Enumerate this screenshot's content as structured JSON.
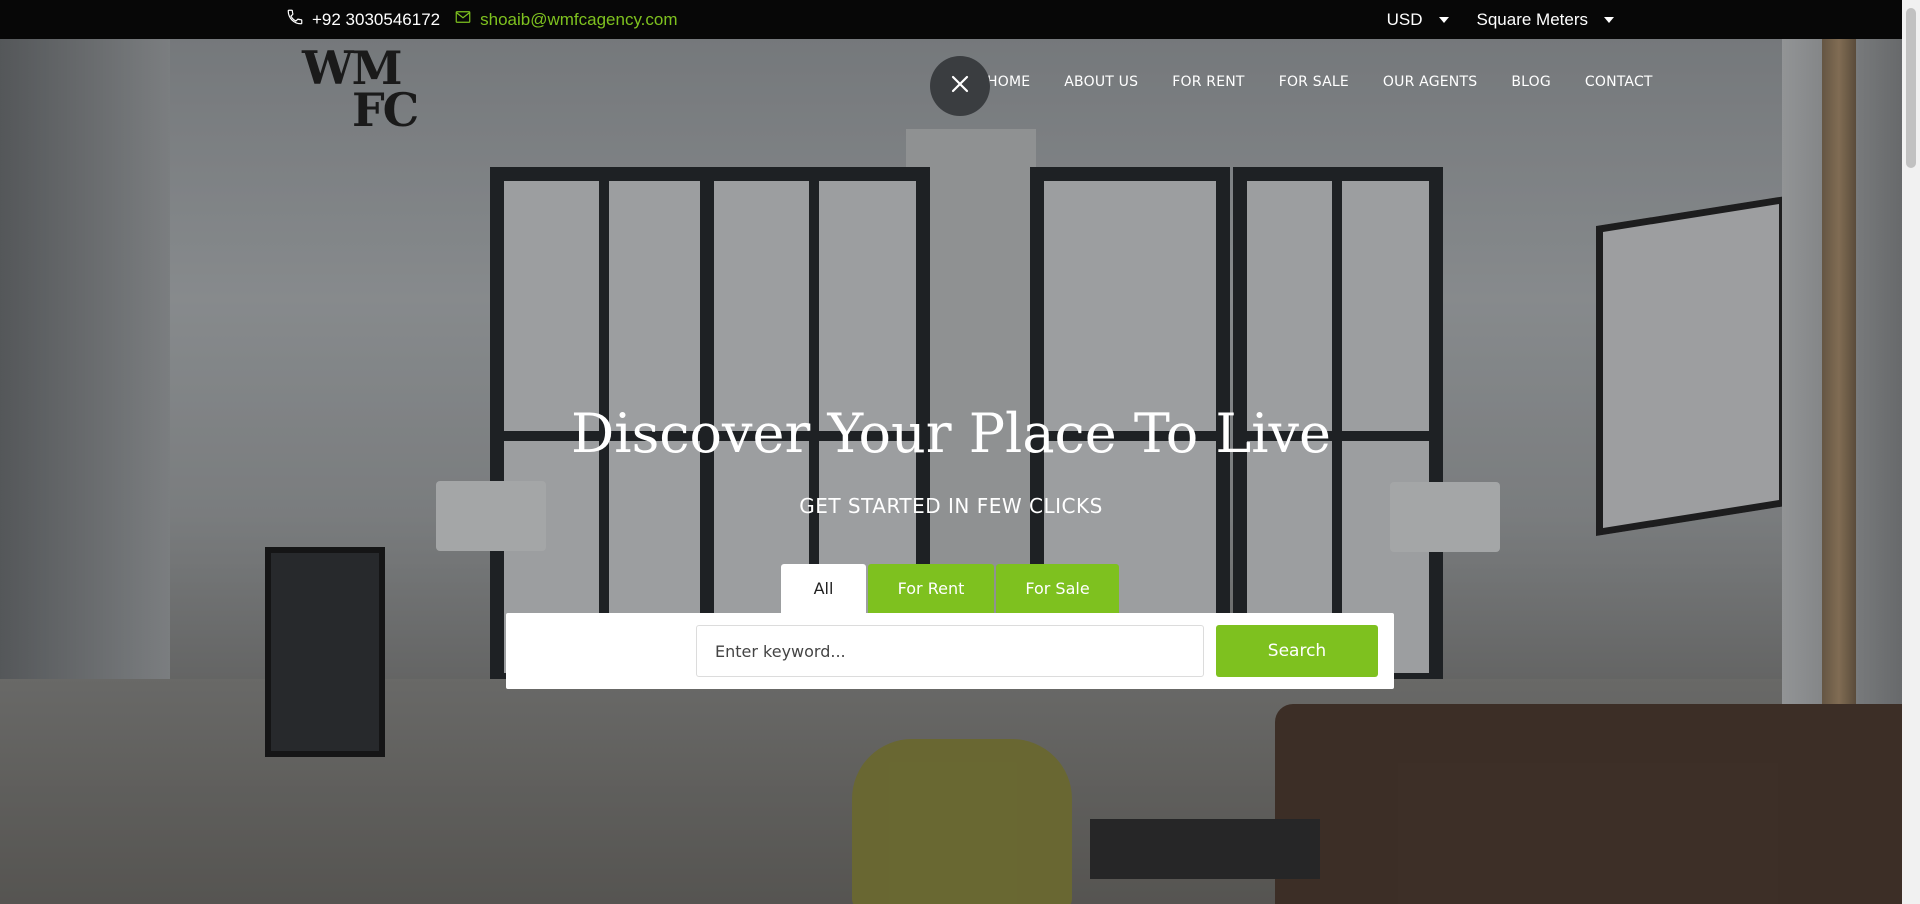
{
  "topbar": {
    "phone": "+92 3030546172",
    "email": "shoaib@wmfcagency.com",
    "currency": "USD",
    "unit": "Square Meters"
  },
  "header": {
    "logo_line1": "WM",
    "logo_line2": "FC",
    "nav": [
      "HOME",
      "ABOUT US",
      "FOR RENT",
      "FOR SALE",
      "OUR AGENTS",
      "BLOG",
      "CONTACT"
    ]
  },
  "hero": {
    "title": "Discover Your Place To Live",
    "subtitle": "GET STARTED IN FEW CLICKS"
  },
  "search": {
    "tabs": [
      "All",
      "For Rent",
      "For Sale"
    ],
    "active_tab": "All",
    "keyword_placeholder": "Enter keyword...",
    "keyword_value": "",
    "button_label": "Search"
  },
  "colors": {
    "accent": "#7ec11f",
    "topbar": "#070707"
  },
  "icons": [
    "phone-icon",
    "mail-icon",
    "close-icon"
  ]
}
